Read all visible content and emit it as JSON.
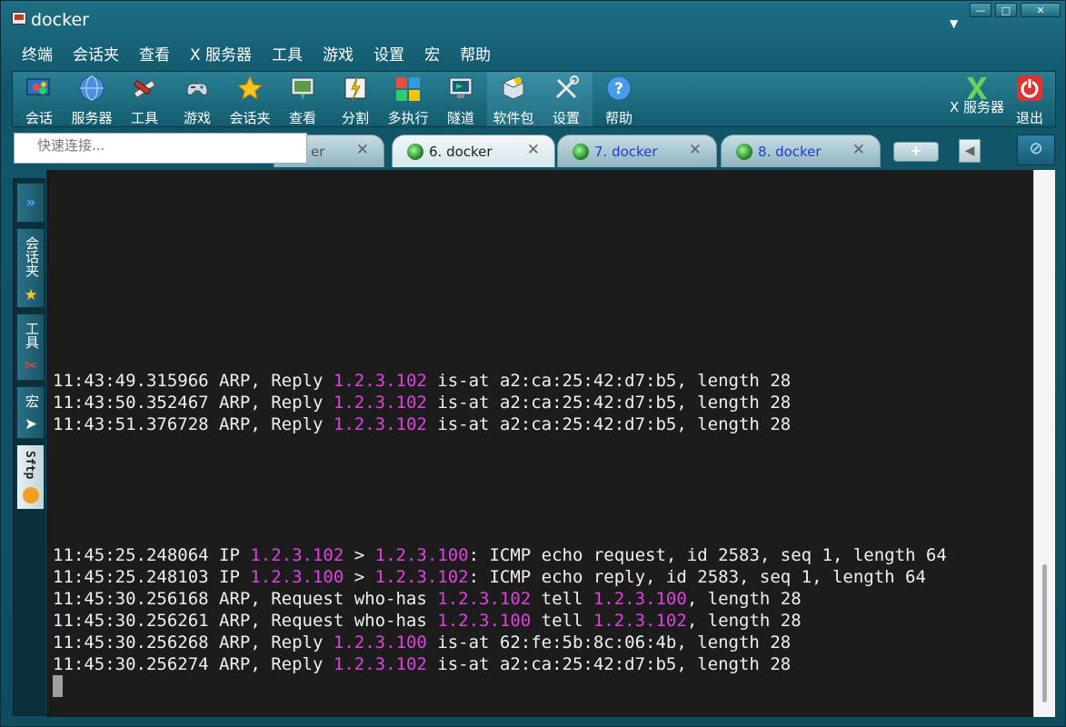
{
  "window": {
    "title": "docker"
  },
  "menu": [
    "终端",
    "会话夹",
    "查看",
    "X 服务器",
    "工具",
    "游戏",
    "设置",
    "宏",
    "帮助"
  ],
  "toolbar": {
    "buttons": [
      {
        "label": "会话",
        "icon": "sessions-icon"
      },
      {
        "label": "服务器",
        "icon": "servers-icon"
      },
      {
        "label": "工具",
        "icon": "tools-icon"
      },
      {
        "label": "游戏",
        "icon": "games-icon"
      },
      {
        "label": "会话夹",
        "icon": "star-icon"
      },
      {
        "label": "查看",
        "icon": "view-icon"
      },
      {
        "label": "分割",
        "icon": "split-icon"
      },
      {
        "label": "多执行",
        "icon": "multiexec-icon"
      },
      {
        "label": "隧道",
        "icon": "tunnel-icon"
      },
      {
        "label": "软件包",
        "icon": "packages-icon"
      },
      {
        "label": "设置",
        "icon": "settings-icon"
      },
      {
        "label": "帮助",
        "icon": "help-icon"
      }
    ],
    "xserver_label": "X 服务器",
    "exit_label": "退出"
  },
  "quick_connect": {
    "placeholder": "快速连接..."
  },
  "tabs": [
    {
      "label": "er",
      "active": false
    },
    {
      "label": "6. docker",
      "active": true
    },
    {
      "label": "7. docker",
      "active": false
    },
    {
      "label": "8. docker",
      "active": false
    }
  ],
  "sidebar": {
    "items": [
      {
        "label": "会话夹",
        "icon": "star-icon"
      },
      {
        "label": "工具",
        "icon": "tools-icon"
      },
      {
        "label": "宏",
        "icon": "macro-icon"
      },
      {
        "label": "Sftp",
        "icon": "sftp-icon"
      }
    ]
  },
  "terminal": {
    "lines": [
      {
        "ts": "11:43:49.315966",
        "text": [
          " ARP, Reply ",
          {
            "ip": "1.2.3.102"
          },
          " is-at a2:ca:25:42:d7:b5, length 28"
        ]
      },
      {
        "ts": "11:43:50.352467",
        "text": [
          " ARP, Reply ",
          {
            "ip": "1.2.3.102"
          },
          " is-at a2:ca:25:42:d7:b5, length 28"
        ]
      },
      {
        "ts": "11:43:51.376728",
        "text": [
          " ARP, Reply ",
          {
            "ip": "1.2.3.102"
          },
          " is-at a2:ca:25:42:d7:b5, length 28"
        ]
      },
      {
        "ts": "11:45:25.248064",
        "text": [
          " IP ",
          {
            "ip": "1.2.3.102"
          },
          " > ",
          {
            "ip": "1.2.3.100"
          },
          ": ICMP echo request, id 2583, seq 1, length 64"
        ]
      },
      {
        "ts": "11:45:25.248103",
        "text": [
          " IP ",
          {
            "ip": "1.2.3.100"
          },
          " > ",
          {
            "ip": "1.2.3.102"
          },
          ": ICMP echo reply, id 2583, seq 1, length 64"
        ]
      },
      {
        "ts": "11:45:30.256168",
        "text": [
          " ARP, Request who-has ",
          {
            "ip": "1.2.3.102"
          },
          " tell ",
          {
            "ip": "1.2.3.100"
          },
          ", length 28"
        ]
      },
      {
        "ts": "11:45:30.256261",
        "text": [
          " ARP, Request who-has ",
          {
            "ip": "1.2.3.100"
          },
          " tell ",
          {
            "ip": "1.2.3.102"
          },
          ", length 28"
        ]
      },
      {
        "ts": "11:45:30.256268",
        "text": [
          " ARP, Reply ",
          {
            "ip": "1.2.3.100"
          },
          " is-at 62:fe:5b:8c:06:4b, length 28"
        ]
      },
      {
        "ts": "11:45:30.256274",
        "text": [
          " ARP, Reply ",
          {
            "ip": "1.2.3.102"
          },
          " is-at a2:ca:25:42:d7:b5, length 28"
        ]
      }
    ]
  },
  "colors": {
    "ip_highlight": "#e040e0",
    "terminal_bg": "#1c1c1c",
    "terminal_fg": "#f0f0f0"
  }
}
